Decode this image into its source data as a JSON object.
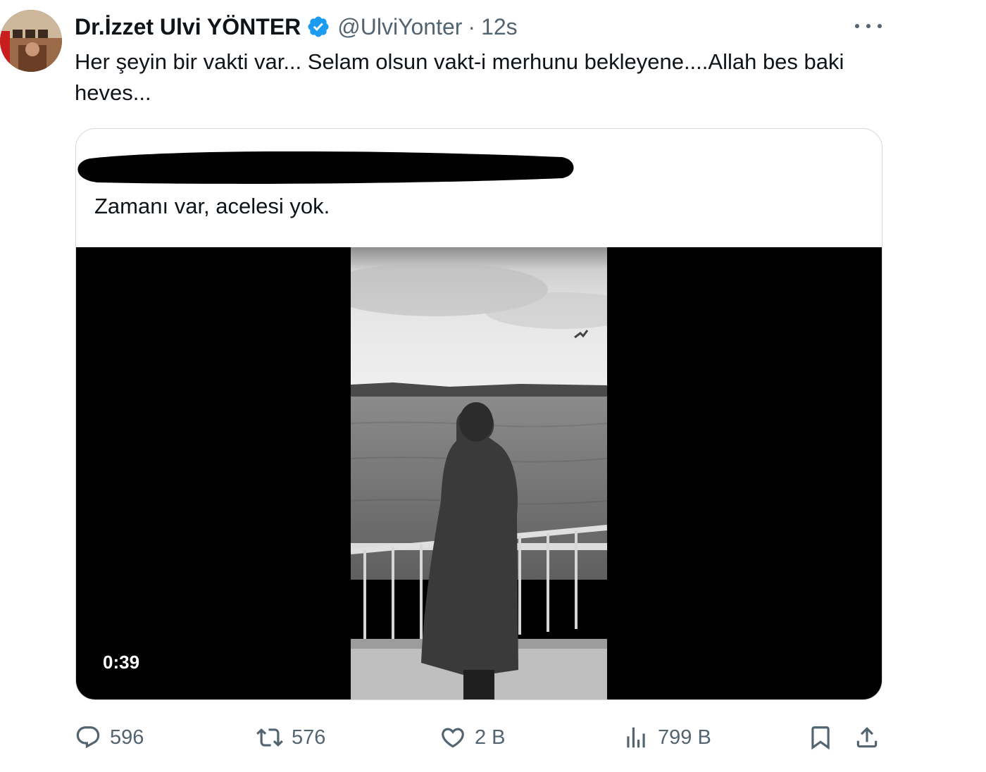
{
  "tweet": {
    "display_name": "Dr.İzzet Ulvi YÖNTER",
    "handle": "@UlviYonter",
    "separator": "·",
    "time": "12s",
    "text": "Her şeyin bir vakti var... Selam olsun vakt-i merhunu bekleyene....Allah bes baki heves...",
    "verified_icon": "verified-badge-icon",
    "accent_color": "#1d9bf0"
  },
  "quote": {
    "text": "Zamanı var, acelesi yok.",
    "video_duration": "0:39"
  },
  "actions": {
    "reply_count": "596",
    "retweet_count": "576",
    "like_count": "2 B",
    "views_count": "799 B",
    "icons": [
      "reply-icon",
      "retweet-icon",
      "like-icon",
      "views-icon",
      "bookmark-icon",
      "share-icon"
    ]
  }
}
